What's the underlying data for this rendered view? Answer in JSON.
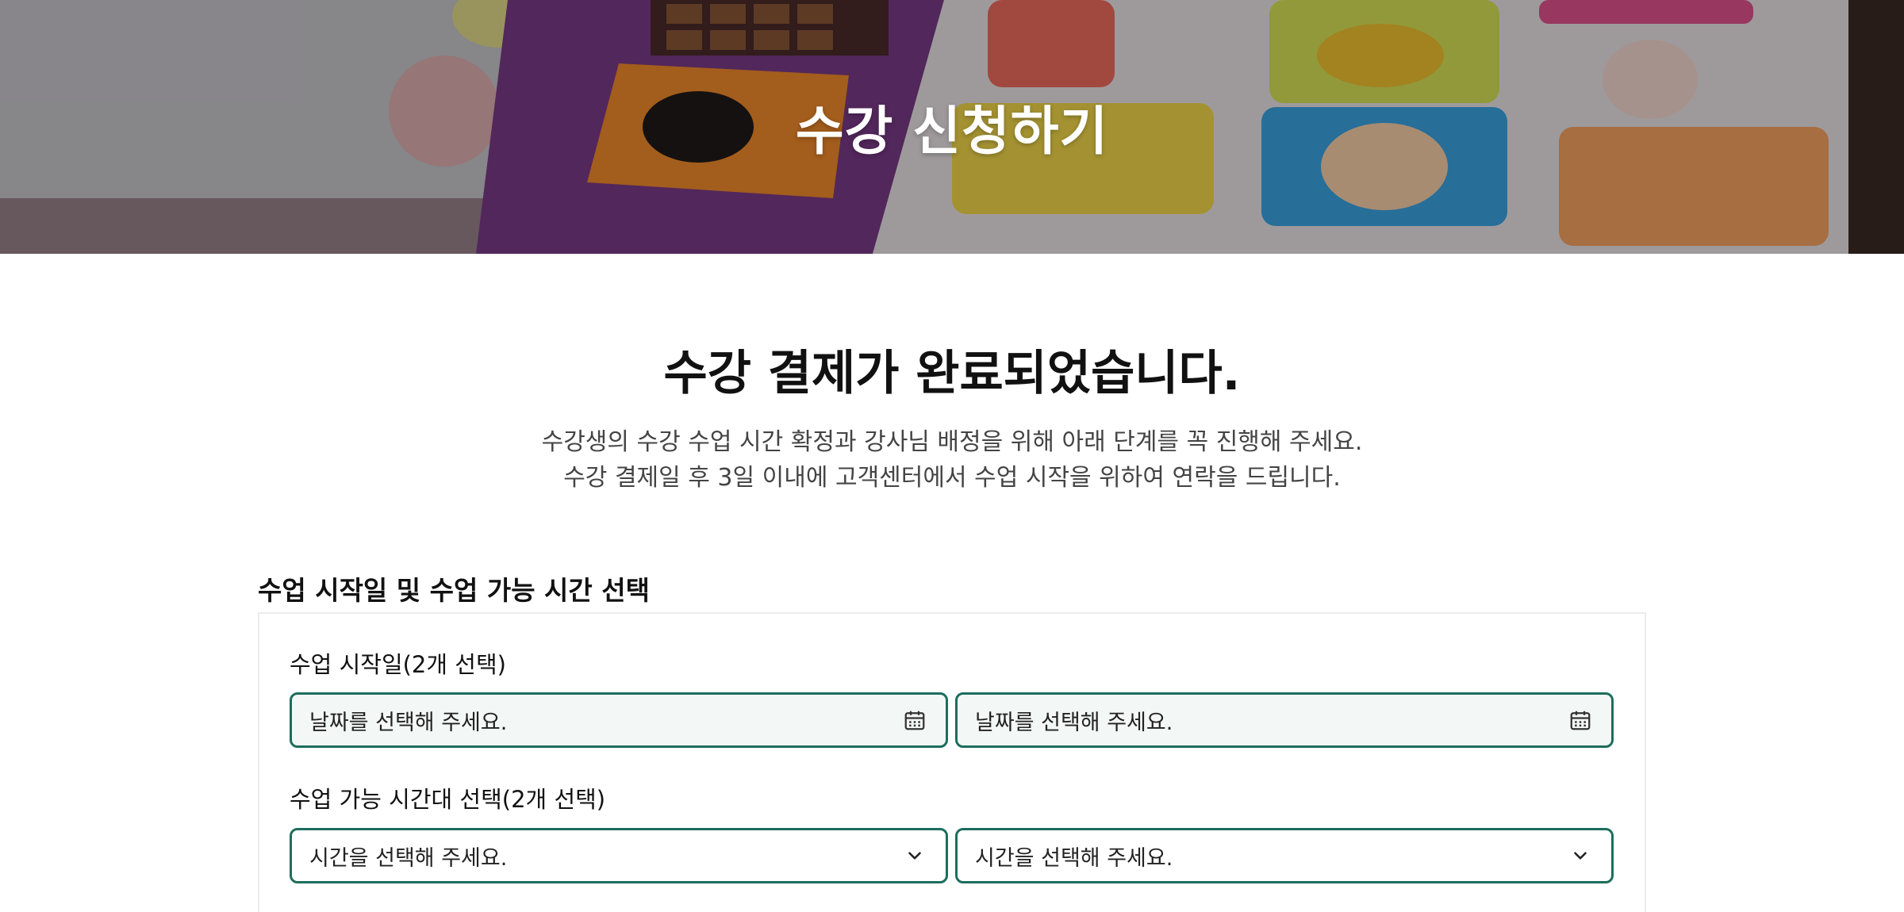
{
  "hero": {
    "title": "수강 신청하기"
  },
  "main": {
    "title": "수강 결제가 완료되었습니다.",
    "subtitle_line1": "수강생의 수강 수업 시간 확정과 강사님 배정을 위해 아래 단계를 꼭 진행해 주세요.",
    "subtitle_line2": "수강 결제일 후 3일 이내에 고객센터에서 수업 시작을 위하여 연락을 드립니다."
  },
  "section": {
    "title": "수업 시작일 및 수업 가능 시간 선택",
    "start_date": {
      "label": "수업 시작일(2개 선택)",
      "placeholder_1": "날짜를 선택해 주세요.",
      "placeholder_2": "날짜를 선택해 주세요.",
      "icon": "calendar-icon"
    },
    "time_slot": {
      "label": "수업 가능 시간대 선택(2개 선택)",
      "placeholder_1": "시간을 선택해 주세요.",
      "placeholder_2": "시간을 선택해 주세요.",
      "icon": "chevron-down-icon"
    }
  },
  "colors": {
    "accent": "#1d6e5c",
    "field_bg": "#f3f7f6",
    "card_border": "#ececec"
  }
}
